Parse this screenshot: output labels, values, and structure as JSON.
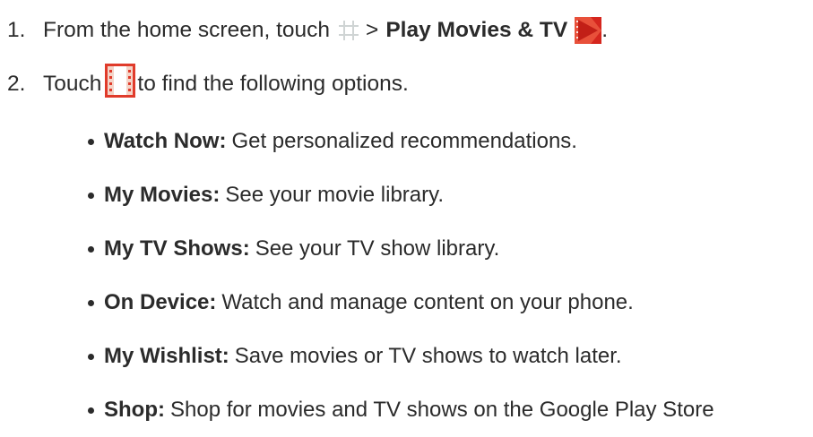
{
  "step1": {
    "number": "1.",
    "text_before": "From the home screen, touch",
    "separator": ">",
    "app_name": "Play Movies & TV",
    "end": ".",
    "apps_icon": "apps-grid-icon",
    "app_icon": "play-movies-icon"
  },
  "step2": {
    "number": "2.",
    "text_before": "Touch",
    "text_after": "to find the following options.",
    "menu_icon": "menu-drawer-icon"
  },
  "options": [
    {
      "term": "Watch Now:",
      "desc": "Get personalized recommendations."
    },
    {
      "term": "My Movies:",
      "desc": "See your movie library."
    },
    {
      "term": "My TV Shows:",
      "desc": "See your TV show library."
    },
    {
      "term": "On Device:",
      "desc": "Watch and manage content on your phone."
    },
    {
      "term": "My Wishlist:",
      "desc": "Save movies or TV shows to watch later."
    },
    {
      "term": "Shop:",
      "desc": "Shop for movies and TV shows on the Google Play Store"
    }
  ],
  "colors": {
    "text": "#2b2b2b",
    "accent_red": "#e03b2b",
    "icon_gray": "#cfd4d4"
  }
}
